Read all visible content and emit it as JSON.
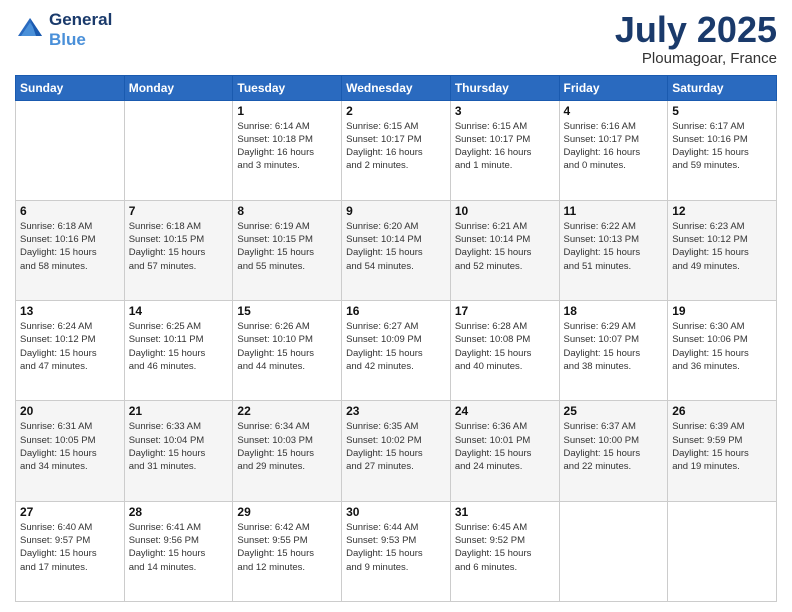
{
  "header": {
    "logo_line1": "General",
    "logo_line2": "Blue",
    "month_title": "July 2025",
    "location": "Ploumagoar, France"
  },
  "days_of_week": [
    "Sunday",
    "Monday",
    "Tuesday",
    "Wednesday",
    "Thursday",
    "Friday",
    "Saturday"
  ],
  "weeks": [
    [
      {
        "day": "",
        "text": ""
      },
      {
        "day": "",
        "text": ""
      },
      {
        "day": "1",
        "text": "Sunrise: 6:14 AM\nSunset: 10:18 PM\nDaylight: 16 hours\nand 3 minutes."
      },
      {
        "day": "2",
        "text": "Sunrise: 6:15 AM\nSunset: 10:17 PM\nDaylight: 16 hours\nand 2 minutes."
      },
      {
        "day": "3",
        "text": "Sunrise: 6:15 AM\nSunset: 10:17 PM\nDaylight: 16 hours\nand 1 minute."
      },
      {
        "day": "4",
        "text": "Sunrise: 6:16 AM\nSunset: 10:17 PM\nDaylight: 16 hours\nand 0 minutes."
      },
      {
        "day": "5",
        "text": "Sunrise: 6:17 AM\nSunset: 10:16 PM\nDaylight: 15 hours\nand 59 minutes."
      }
    ],
    [
      {
        "day": "6",
        "text": "Sunrise: 6:18 AM\nSunset: 10:16 PM\nDaylight: 15 hours\nand 58 minutes."
      },
      {
        "day": "7",
        "text": "Sunrise: 6:18 AM\nSunset: 10:15 PM\nDaylight: 15 hours\nand 57 minutes."
      },
      {
        "day": "8",
        "text": "Sunrise: 6:19 AM\nSunset: 10:15 PM\nDaylight: 15 hours\nand 55 minutes."
      },
      {
        "day": "9",
        "text": "Sunrise: 6:20 AM\nSunset: 10:14 PM\nDaylight: 15 hours\nand 54 minutes."
      },
      {
        "day": "10",
        "text": "Sunrise: 6:21 AM\nSunset: 10:14 PM\nDaylight: 15 hours\nand 52 minutes."
      },
      {
        "day": "11",
        "text": "Sunrise: 6:22 AM\nSunset: 10:13 PM\nDaylight: 15 hours\nand 51 minutes."
      },
      {
        "day": "12",
        "text": "Sunrise: 6:23 AM\nSunset: 10:12 PM\nDaylight: 15 hours\nand 49 minutes."
      }
    ],
    [
      {
        "day": "13",
        "text": "Sunrise: 6:24 AM\nSunset: 10:12 PM\nDaylight: 15 hours\nand 47 minutes."
      },
      {
        "day": "14",
        "text": "Sunrise: 6:25 AM\nSunset: 10:11 PM\nDaylight: 15 hours\nand 46 minutes."
      },
      {
        "day": "15",
        "text": "Sunrise: 6:26 AM\nSunset: 10:10 PM\nDaylight: 15 hours\nand 44 minutes."
      },
      {
        "day": "16",
        "text": "Sunrise: 6:27 AM\nSunset: 10:09 PM\nDaylight: 15 hours\nand 42 minutes."
      },
      {
        "day": "17",
        "text": "Sunrise: 6:28 AM\nSunset: 10:08 PM\nDaylight: 15 hours\nand 40 minutes."
      },
      {
        "day": "18",
        "text": "Sunrise: 6:29 AM\nSunset: 10:07 PM\nDaylight: 15 hours\nand 38 minutes."
      },
      {
        "day": "19",
        "text": "Sunrise: 6:30 AM\nSunset: 10:06 PM\nDaylight: 15 hours\nand 36 minutes."
      }
    ],
    [
      {
        "day": "20",
        "text": "Sunrise: 6:31 AM\nSunset: 10:05 PM\nDaylight: 15 hours\nand 34 minutes."
      },
      {
        "day": "21",
        "text": "Sunrise: 6:33 AM\nSunset: 10:04 PM\nDaylight: 15 hours\nand 31 minutes."
      },
      {
        "day": "22",
        "text": "Sunrise: 6:34 AM\nSunset: 10:03 PM\nDaylight: 15 hours\nand 29 minutes."
      },
      {
        "day": "23",
        "text": "Sunrise: 6:35 AM\nSunset: 10:02 PM\nDaylight: 15 hours\nand 27 minutes."
      },
      {
        "day": "24",
        "text": "Sunrise: 6:36 AM\nSunset: 10:01 PM\nDaylight: 15 hours\nand 24 minutes."
      },
      {
        "day": "25",
        "text": "Sunrise: 6:37 AM\nSunset: 10:00 PM\nDaylight: 15 hours\nand 22 minutes."
      },
      {
        "day": "26",
        "text": "Sunrise: 6:39 AM\nSunset: 9:59 PM\nDaylight: 15 hours\nand 19 minutes."
      }
    ],
    [
      {
        "day": "27",
        "text": "Sunrise: 6:40 AM\nSunset: 9:57 PM\nDaylight: 15 hours\nand 17 minutes."
      },
      {
        "day": "28",
        "text": "Sunrise: 6:41 AM\nSunset: 9:56 PM\nDaylight: 15 hours\nand 14 minutes."
      },
      {
        "day": "29",
        "text": "Sunrise: 6:42 AM\nSunset: 9:55 PM\nDaylight: 15 hours\nand 12 minutes."
      },
      {
        "day": "30",
        "text": "Sunrise: 6:44 AM\nSunset: 9:53 PM\nDaylight: 15 hours\nand 9 minutes."
      },
      {
        "day": "31",
        "text": "Sunrise: 6:45 AM\nSunset: 9:52 PM\nDaylight: 15 hours\nand 6 minutes."
      },
      {
        "day": "",
        "text": ""
      },
      {
        "day": "",
        "text": ""
      }
    ]
  ]
}
